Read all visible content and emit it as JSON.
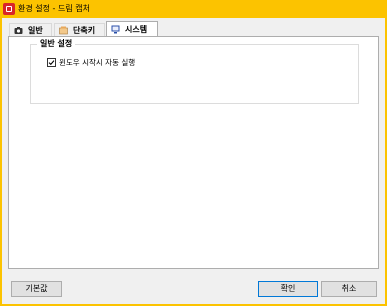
{
  "window": {
    "title": "환경 설정 - 드림 캡처"
  },
  "tabs": [
    {
      "label": "일반",
      "icon": "camera-icon",
      "active": false
    },
    {
      "label": "단축키",
      "icon": "keyboard-shortcut-icon",
      "active": false
    },
    {
      "label": "시스템",
      "icon": "system-icon",
      "active": true
    }
  ],
  "group": {
    "title": "일반 설정",
    "options": [
      {
        "label": "윈도우 시작시 자동 실행",
        "checked": true
      }
    ]
  },
  "buttons": {
    "default_label": "기본값",
    "ok_label": "확인",
    "cancel_label": "취소"
  },
  "colors": {
    "titlebar": "#fcc300",
    "client": "#f0f0f0",
    "app_icon": "#d8262a",
    "focus_border": "#0078d7"
  }
}
